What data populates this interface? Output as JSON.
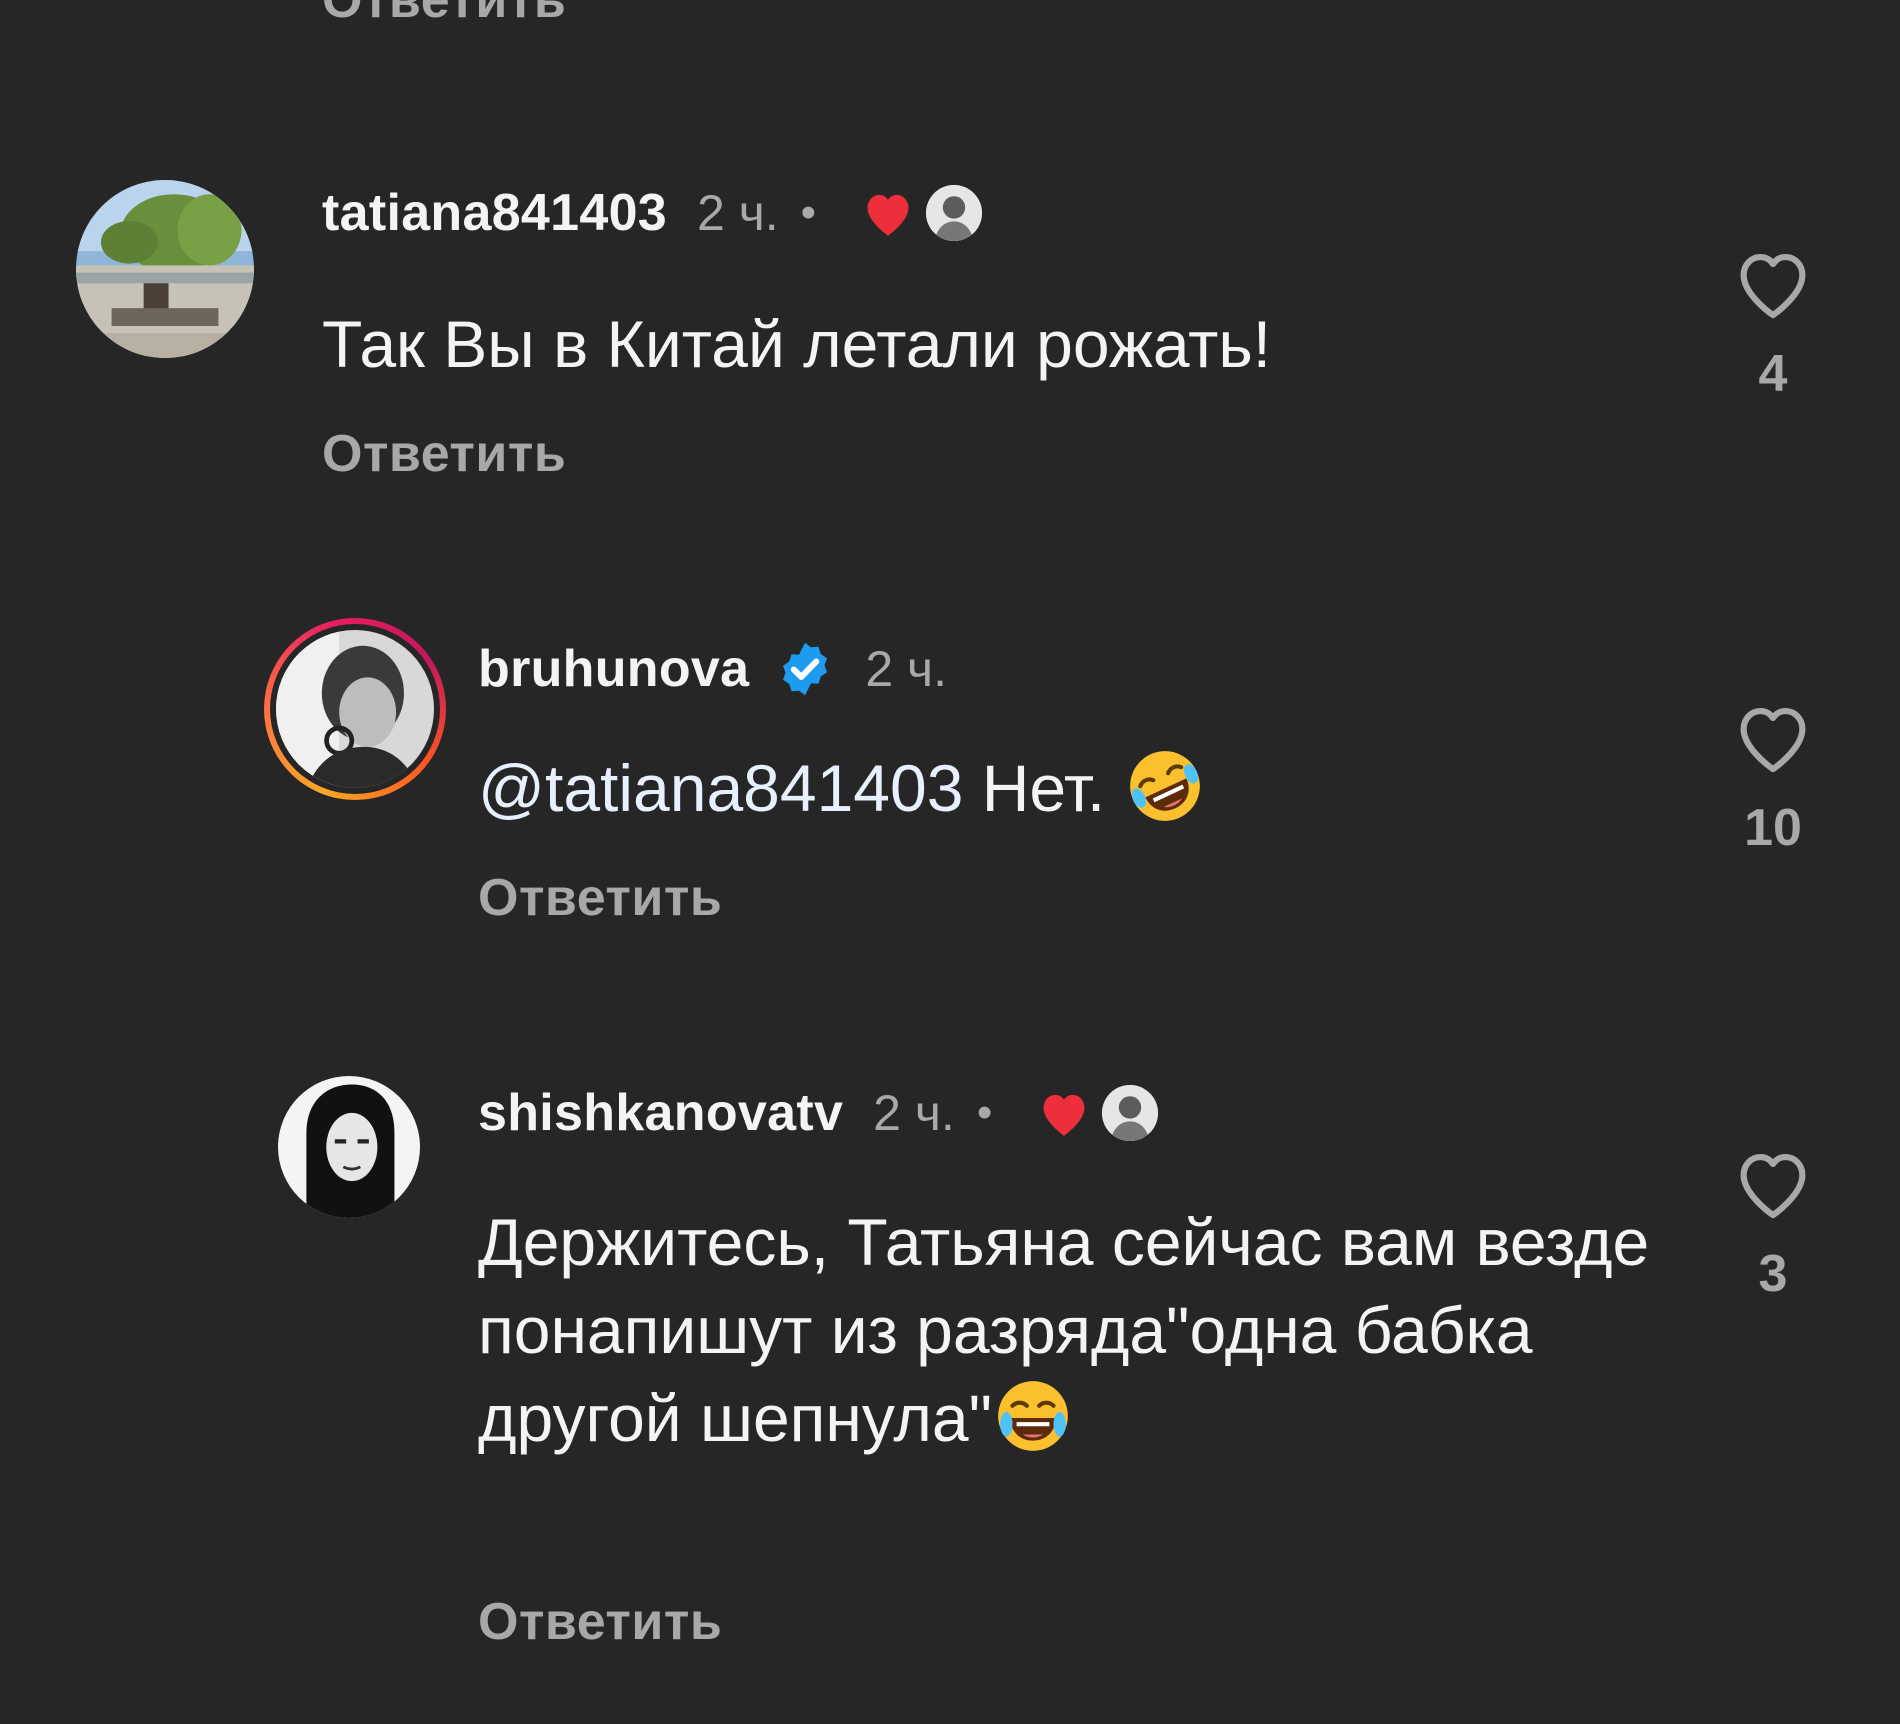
{
  "top_reply_label": "Ответить",
  "comments": [
    {
      "username": "tatiana841403",
      "time": "2 ч.",
      "dot": "•",
      "text": "Так Вы в Китай летали рожать!",
      "reply_label": "Ответить",
      "likes": "4",
      "liked_by_author": true
    },
    {
      "username": "bruhunova",
      "time": "2 ч.",
      "verified": true,
      "mention": "@tatiana841403",
      "text": " Нет.",
      "emoji": "rolling-on-floor-laughing-emoji",
      "reply_label": "Ответить",
      "likes": "10"
    },
    {
      "username": "shishkanovatv",
      "time": "2 ч.",
      "dot": "•",
      "text": "Держитесь, Татьяна сейчас вам везде понапишут из разряда\"одна бабка другой шепнула\"",
      "emoji": "tears-of-joy-emoji",
      "reply_label": "Ответить",
      "likes": "3",
      "liked_by_author": true
    }
  ],
  "colors": {
    "background": "#262626",
    "text": "#f4f4f4",
    "secondary": "#a8a8a8",
    "heart_red": "#ed2e3b",
    "verified_blue": "#1d9bf0"
  }
}
